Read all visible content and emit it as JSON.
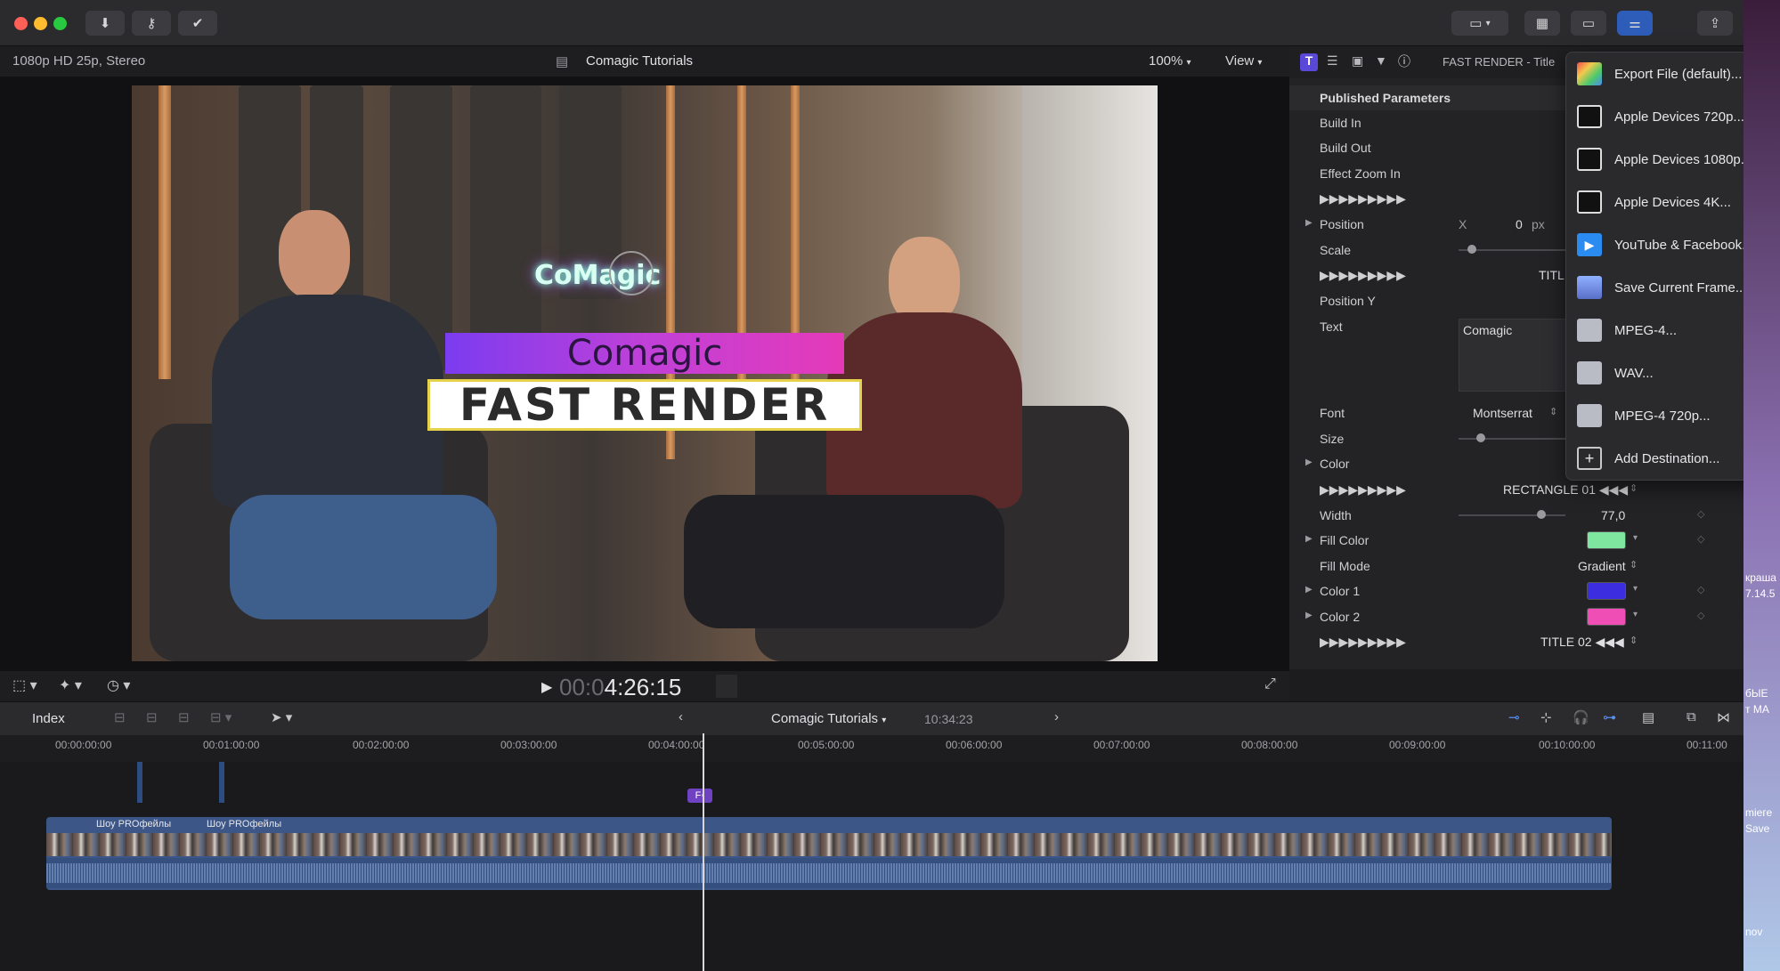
{
  "titlebar": {
    "tools": [
      "download-icon",
      "key-icon",
      "check-circle-icon"
    ]
  },
  "viewer": {
    "format": "1080p HD 25p, Stereo",
    "project": "Comagic Tutorials",
    "zoom": "100%",
    "view_label": "View",
    "logo_text": "CoMagic",
    "title_top": "Comagic",
    "title_bottom": "FAST RENDER"
  },
  "transport": {
    "timecode_dim": "00:0",
    "timecode": "4:26:15"
  },
  "inspector": {
    "header_title": "FAST RENDER - Title",
    "section": "Published Parameters",
    "rows": {
      "build_in": "Build In",
      "build_out": "Build Out",
      "effect_zoom": "Effect Zoom In",
      "sep1": "▶▶▶▶▶▶▶▶▶",
      "position": "Position",
      "position_axis": "X",
      "position_value": "0",
      "position_unit": "px",
      "scale": "Scale",
      "sep2": "▶▶▶▶▶▶▶▶▶",
      "sep2_right": "TITL",
      "position_y": "Position Y",
      "text": "Text",
      "text_value": "Comagic",
      "font": "Font",
      "font_value": "Montserrat",
      "size": "Size",
      "color": "Color",
      "sep3": "▶▶▶▶▶▶▶▶▶",
      "sep3_right": "RECTANGLE 01 ◀◀◀",
      "width": "Width",
      "width_value": "77,0",
      "fill_color": "Fill Color",
      "fill_mode": "Fill Mode",
      "fill_mode_value": "Gradient",
      "color1": "Color 1",
      "color2": "Color 2",
      "sep4": "▶▶▶▶▶▶▶▶▶",
      "sep4_right": "TITLE 02 ◀◀◀"
    },
    "colors": {
      "fill": "#7fe6a0",
      "color1": "#3c2ee0",
      "color2": "#ef4fb4"
    }
  },
  "share_menu": {
    "items": [
      {
        "label": "Export File (default)...",
        "icon": "export-file-icon"
      },
      {
        "label": "Apple Devices 720p...",
        "icon": "apple-device-icon"
      },
      {
        "label": "Apple Devices 1080p...",
        "icon": "apple-device-icon"
      },
      {
        "label": "Apple Devices 4K...",
        "icon": "apple-device-icon"
      },
      {
        "label": "YouTube & Facebook...",
        "icon": "youtube-icon"
      },
      {
        "label": "Save Current Frame...",
        "icon": "save-frame-icon"
      },
      {
        "label": "MPEG-4...",
        "icon": "mpeg-icon"
      },
      {
        "label": "WAV...",
        "icon": "wav-icon"
      },
      {
        "label": "MPEG-4 720p...",
        "icon": "mpeg-icon"
      },
      {
        "label": "Add Destination...",
        "icon": "add-icon"
      }
    ]
  },
  "timeline": {
    "index_label": "Index",
    "project": "Comagic Tutorials",
    "duration": "10:34:23",
    "ruler": [
      "00:00:00:00",
      "00:01:00:00",
      "00:02:00:00",
      "00:03:00:00",
      "00:04:00:00",
      "00:05:00:00",
      "00:06:00:00",
      "00:07:00:00",
      "00:08:00:00",
      "00:09:00:00",
      "00:10:00:00",
      "00:11:00"
    ],
    "clip_label_1": "Шоу PROфейлы",
    "clip_label_2": "Шоу PROфейлы",
    "marker": "F"
  },
  "desktop_edge": {
    "text1": "бЫЕ",
    "text2": "т МА",
    "text3": "mіеге",
    "text4": "Save",
    "text5": "nov",
    "text6": "краша",
    "text7": "7.14.5"
  }
}
